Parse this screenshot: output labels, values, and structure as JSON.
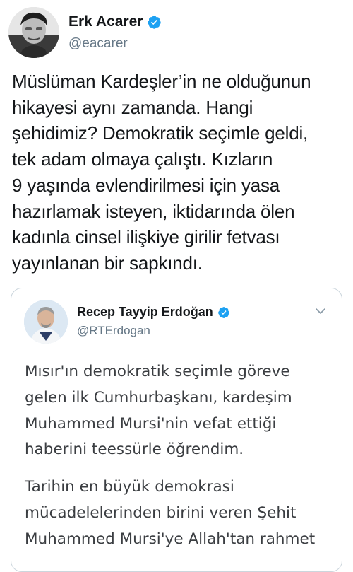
{
  "tweet": {
    "author": {
      "name": "Erk Acarer",
      "handle": "@eacarer",
      "verified": true
    },
    "text": "Müslüman Kardeşler’in ne olduğunun\nhikayesi aynı zamanda. Hangi\nşehidimiz? Demokratik seçimle geldi,\ntek adam olmaya çalıştı. Kızların\n9 yaşında evlendirilmesi için yasa\nhazırlamak isteyen, iktidarında ölen\nkadınla cinsel ilişkiye girilir fetvası\nyayınlanan bir sapkındı."
  },
  "quoted": {
    "author": {
      "name": "Recep Tayyip Erdoğan",
      "handle": "@RTErdogan",
      "verified": true
    },
    "paragraphs": [
      "Mısır'ın demokratik seçimle göreve\ngelen ilk Cumhurbaşkanı, kardeşim\nMuhammed Mursi'nin vefat ettiği\nhaberini teessürle öğrendim.",
      "Tarihin en büyük demokrasi\nmücadelelerinden birini veren Şehit\nMuhammed Mursi'ye Allah'tan rahmet"
    ]
  },
  "colors": {
    "verified_blue": "#1da1f2",
    "secondary_text": "#657786",
    "border": "#ccd6dd"
  },
  "icons": {
    "verified": "verified-badge-icon",
    "chevron": "chevron-down-icon"
  }
}
